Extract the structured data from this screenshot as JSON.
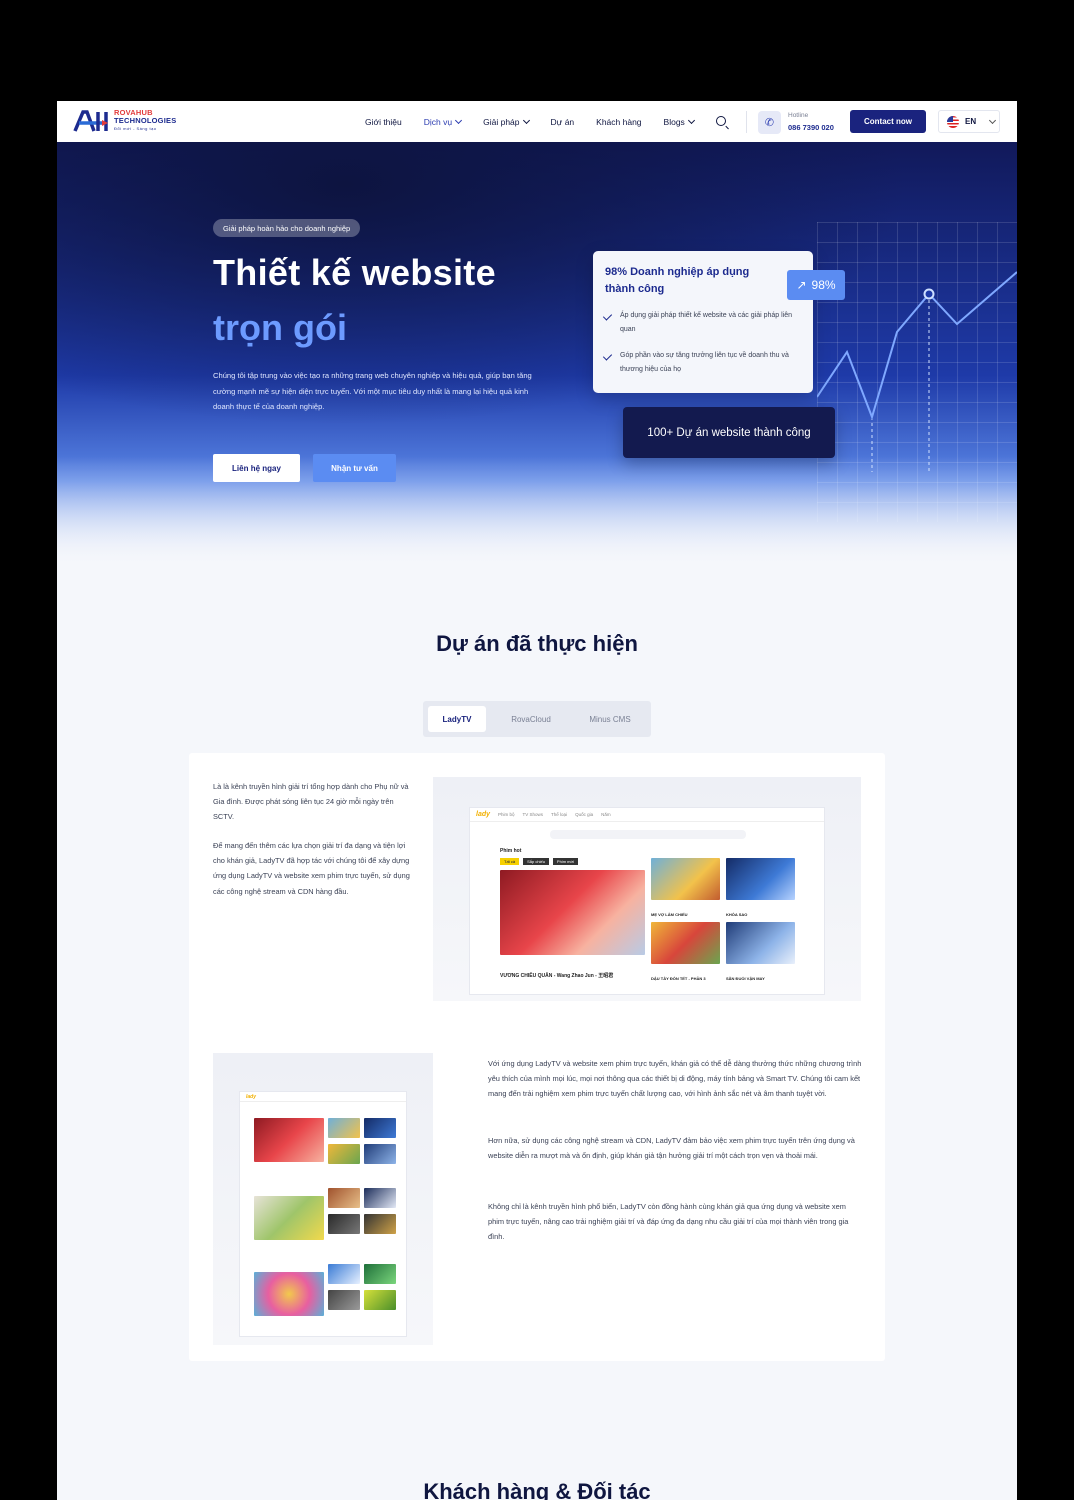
{
  "header": {
    "logo_line1": "ROVAHUB",
    "logo_line2": "TECHNOLOGIES",
    "logo_tagline": "Đổi mới - Sáng tạo",
    "nav": [
      {
        "label": "Giới thiệu",
        "has_dropdown": false
      },
      {
        "label": "Dịch vụ",
        "has_dropdown": true
      },
      {
        "label": "Giải pháp",
        "has_dropdown": true
      },
      {
        "label": "Dự án",
        "has_dropdown": false
      },
      {
        "label": "Khách hàng",
        "has_dropdown": false
      },
      {
        "label": "Blogs",
        "has_dropdown": true
      }
    ],
    "hotline_label": "Hotline",
    "hotline_number": "086 7390 020",
    "contact_button": "Contact now",
    "language": "EN"
  },
  "hero": {
    "badge": "Giải pháp hoàn hảo cho doanh nghiệp",
    "title_line1": "Thiết kế website",
    "title_line2": "trọn gói",
    "description": "Chúng tôi tập trung vào việc tạo ra những trang web chuyên nghiệp và hiệu quả, giúp bạn tăng cường mạnh mẽ sự hiện diện trực tuyến. Với một mục tiêu duy nhất là mang lại hiệu quả kinh doanh thực tế của doanh nghiệp.",
    "primary_button": "Liên hệ ngay",
    "secondary_button": "Nhận tư vấn",
    "stat_card_title": "98% Doanh nghiệp áp dụng thành công",
    "stat_card_points": [
      "Áp dụng giải pháp thiết kế website và các giải pháp liên quan",
      "Góp phần vào sự tăng trưởng liên tục về doanh thu và thương hiệu của họ"
    ],
    "stat_pill": "98%",
    "projects_card": "100+ Dự án website thành công"
  },
  "projects": {
    "title": "Dự án đã thực hiện",
    "tabs": [
      "LadyTV",
      "RovaCloud",
      "Minus CMS"
    ],
    "active_tab": "LadyTV",
    "block1_paragraphs": [
      "Là là kênh truyền hình giải trí tổng hợp dành cho Phụ nữ và Gia đình. Được phát sóng liên tục 24 giờ mỗi ngày trên SCTV.",
      "Để mang đến thêm các lựa chọn giải trí đa dạng và tiện lợi cho khán giả, LadyTV đã hợp tác với chúng tôi để xây dựng ứng dụng LadyTV và website xem phim trực tuyến, sử dụng các công nghệ stream và CDN hàng đầu."
    ],
    "block2_paragraphs": [
      "Với ứng dụng LadyTV và website xem phim trực tuyến, khán giả có thể dễ dàng thưởng thức những chương trình yêu thích của mình mọi lúc, mọi nơi thông qua các thiết bị di động, máy tính bảng và Smart TV. Chúng tôi cam kết mang đến trải nghiệm xem phim trực tuyến chất lượng cao, với hình ảnh sắc nét và âm thanh tuyệt vời.",
      "Hơn nữa, sử dụng các công nghệ stream và CDN, LadyTV đảm bảo việc xem phim trực tuyến trên ứng dụng và website diễn ra mượt mà và ổn định, giúp khán giả tận hưởng giải trí một cách trọn vẹn và thoải mái.",
      "Không chỉ là kênh truyền hình phổ biến, LadyTV còn đồng hành cùng khán giả qua ứng dụng và website xem phim trực tuyến, nâng cao trải nghiệm giải trí và đáp ứng đa dạng nhu cầu giải trí của mọi thành viên trong gia đình."
    ],
    "mock": {
      "logo": "lady",
      "nav": [
        "Phim bộ",
        "TV Shows",
        "Thể loại",
        "Quốc gia",
        "Năm"
      ],
      "section": "Phim hot",
      "chips": [
        "Tất cả",
        "Sắp chiếu",
        "Phim mới"
      ],
      "featured": "VƯƠNG CHIÊU QUÂN - Wang Zhao Jun - 王昭君",
      "items": [
        "MẸ VỢ LÂM CHIẾU",
        "KHÓA SAO",
        "DẬU TÂY ĐÓN TẾT - PHẦN 3",
        "SĂN ĐUỔI VẬN MAY"
      ]
    }
  },
  "next_section_title": "Khách hàng & Đối tác",
  "colors": {
    "brand": "#1a237e",
    "accent": "#5b8cf2",
    "hero_highlight": "#6d9bff"
  }
}
